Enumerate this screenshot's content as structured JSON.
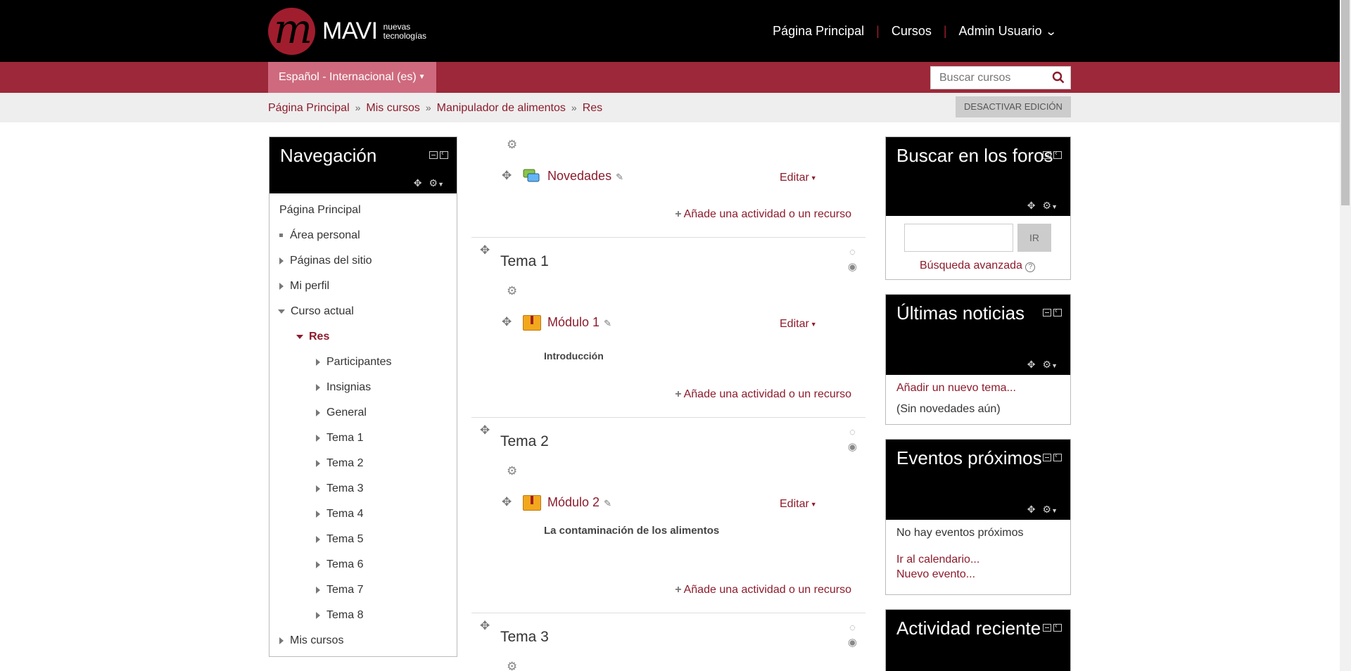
{
  "header": {
    "logo_text": "MAVI",
    "logo_subtitle_line1": "nuevas",
    "logo_subtitle_line2": "tecnologías",
    "nav": [
      "Página Principal",
      "Cursos",
      "Admin Usuario"
    ],
    "accent_color": "#9c2839"
  },
  "language": {
    "label": "Español - Internacional (es)"
  },
  "search": {
    "placeholder": "Buscar cursos",
    "icon": "search-icon"
  },
  "breadcrumb": [
    "Página Principal",
    "Mis cursos",
    "Manipulador de alimentos",
    "Res"
  ],
  "edit_toggle": "DESACTIVAR EDICIÓN",
  "navigation_block": {
    "title": "Navegación",
    "items": {
      "home": "Página Principal",
      "area": "Área personal",
      "site_pages": "Páginas del sitio",
      "profile": "Mi perfil",
      "current_course": "Curso actual",
      "course": "Res",
      "participants": "Participantes",
      "badges": "Insignias",
      "general": "General",
      "topics": [
        "Tema 1",
        "Tema 2",
        "Tema 3",
        "Tema 4",
        "Tema 5",
        "Tema 6",
        "Tema 7",
        "Tema 8"
      ],
      "my_courses": "Mis cursos"
    }
  },
  "main": {
    "general_section": {
      "activity": "Novedades",
      "edit": "Editar",
      "add": "Añade una actividad o un recurso"
    },
    "sections": [
      {
        "title": "Tema 1",
        "activity": "Módulo 1",
        "summary": "Introducción",
        "edit": "Editar",
        "add": "Añade una actividad o un recurso"
      },
      {
        "title": "Tema 2",
        "activity": "Módulo 2",
        "summary": "La contaminación de los alimentos",
        "edit": "Editar",
        "add": "Añade una actividad o un recurso"
      },
      {
        "title": "Tema 3"
      }
    ]
  },
  "forum_search_block": {
    "title": "Buscar en los foros",
    "button": "IR",
    "advanced": "Búsqueda avanzada"
  },
  "news_block": {
    "title": "Últimas noticias",
    "add_link": "Añadir un nuevo tema...",
    "empty": "(Sin novedades aún)"
  },
  "events_block": {
    "title": "Eventos próximos",
    "empty": "No hay eventos próximos",
    "calendar_link": "Ir al calendario...",
    "new_event_link": "Nuevo evento..."
  },
  "activity_block": {
    "title": "Actividad reciente"
  }
}
